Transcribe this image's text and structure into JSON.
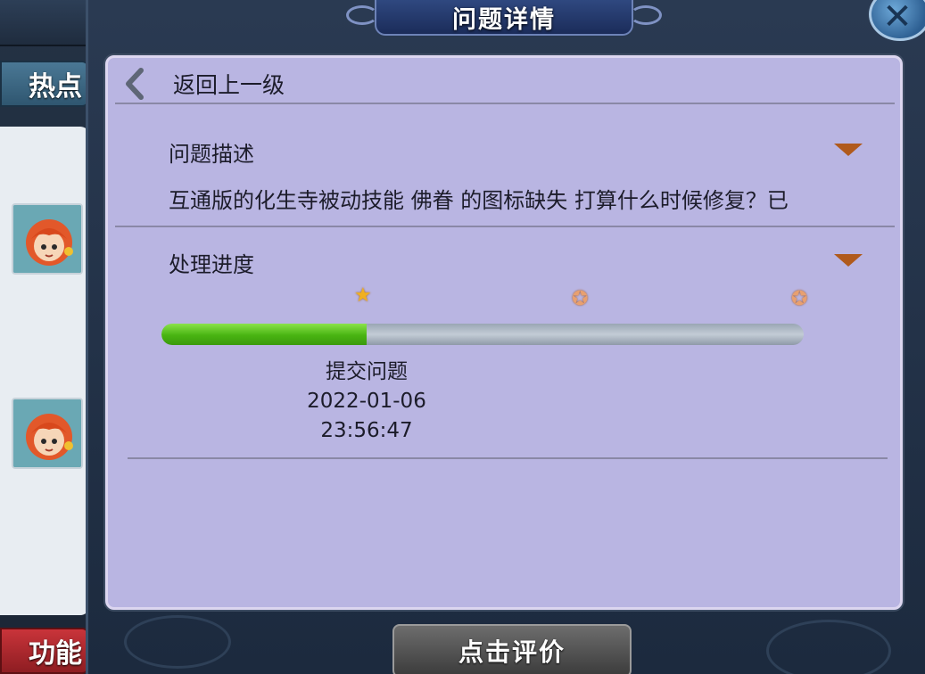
{
  "background_window": {
    "tab_hot": "热点",
    "tab_function": "功能"
  },
  "dialog": {
    "title": "问题详情",
    "close_icon": "close-x-icon"
  },
  "back": {
    "icon": "chevron-left-icon",
    "label": "返回上一级"
  },
  "description": {
    "title": "问题描述",
    "text": "互通版的化生寺被动技能 佛眷 的图标缺失 打算什么时候修复？已",
    "toggle_icon": "dropdown-triangle-icon"
  },
  "progress": {
    "title": "处理进度",
    "toggle_icon": "dropdown-triangle-icon",
    "fill_fraction": 0.32,
    "steps_total": 3,
    "steps_completed": 1,
    "current_stage": {
      "label": "提交问题",
      "date": "2022-01-06",
      "time": "23:56:47"
    }
  },
  "rate_button": {
    "label": "点击评价"
  },
  "colors": {
    "panel_bg": "#b9b5e2",
    "progress_fill": "#49b412",
    "triangle": "#b05a1c",
    "title_plate": "#1b2c5a"
  }
}
